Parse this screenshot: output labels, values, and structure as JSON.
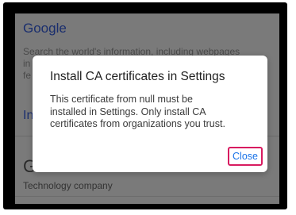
{
  "background_page": {
    "result_title": "Google",
    "description_lines": [
      "Search the world's information, including webpages",
      "in",
      "fe"
    ],
    "partial_link": "In",
    "card_heading_initial": "G",
    "card_subtitle": "Technology company"
  },
  "dialog": {
    "title": "Install CA certificates in Settings",
    "body_lines": [
      "This certificate from null must be",
      "installed in Settings. Only install CA",
      "certificates from organizations you trust."
    ],
    "close_label": "Close"
  },
  "colors": {
    "scrim": "#7a7a7a",
    "link_blue": "#1a2e6e",
    "button_text": "#1a73e8",
    "highlight_border": "#d81b60"
  }
}
